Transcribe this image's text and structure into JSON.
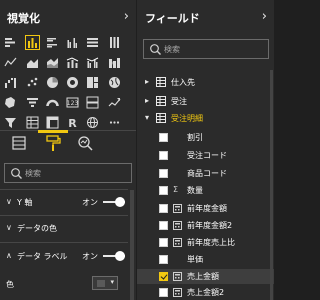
{
  "viz_pane": {
    "title": "視覚化",
    "collapse_glyph": "›",
    "search_placeholder": "検索",
    "sections": {
      "y_axis": "Y 軸",
      "y_axis_toggle": "オン",
      "data_color": "データの色",
      "data_labels": "データ ラベル",
      "data_labels_toggle": "オン",
      "color": "色"
    },
    "toggle_states": {
      "y_axis": true,
      "data_labels": true
    },
    "accent": "#f2c811"
  },
  "fields_pane": {
    "title": "フィールド",
    "collapse_glyph": "›",
    "search_placeholder": "検索",
    "tables": [
      {
        "name": "仕入先",
        "expanded": false
      },
      {
        "name": "受注",
        "expanded": false
      },
      {
        "name": "受注明細",
        "expanded": true
      }
    ],
    "fields": [
      {
        "name": "割引",
        "checked": false,
        "icon": "none"
      },
      {
        "name": "受注コード",
        "checked": false,
        "icon": "none"
      },
      {
        "name": "商品コード",
        "checked": false,
        "icon": "none"
      },
      {
        "name": "数量",
        "checked": false,
        "icon": "sigma"
      },
      {
        "name": "前年度金額",
        "checked": false,
        "icon": "calc"
      },
      {
        "name": "前年度金額2",
        "checked": false,
        "icon": "calc"
      },
      {
        "name": "前年度売上比",
        "checked": false,
        "icon": "calc"
      },
      {
        "name": "単価",
        "checked": false,
        "icon": "none"
      },
      {
        "name": "売上金額",
        "checked": true,
        "icon": "calc"
      },
      {
        "name": "売上金額2",
        "checked": false,
        "icon": "calc"
      }
    ],
    "sigma_glyph": "Σ"
  }
}
